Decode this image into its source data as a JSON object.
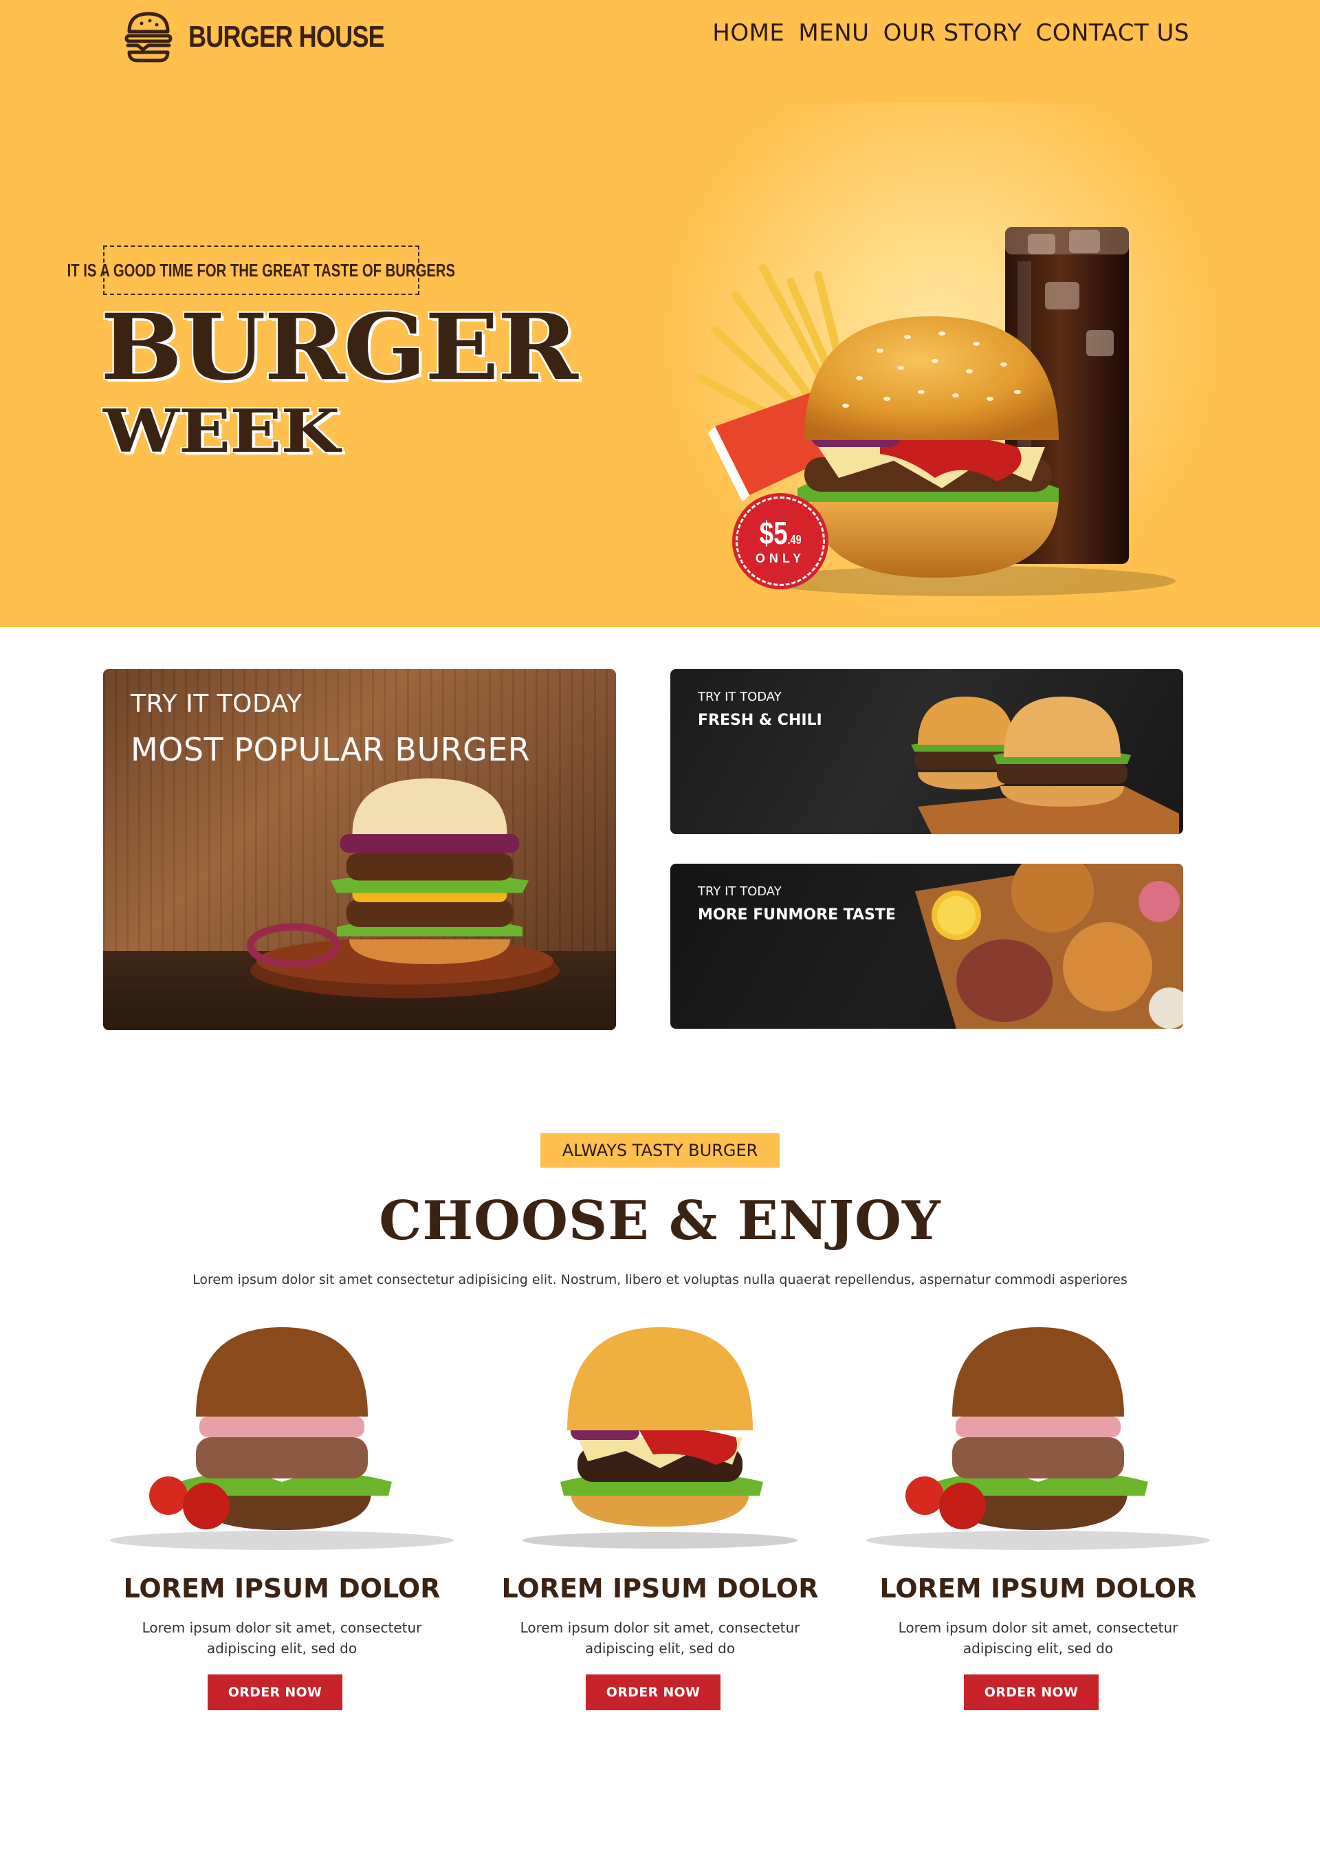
{
  "brand": {
    "name": "BURGER HOUSE",
    "icon": "burger-icon"
  },
  "nav": {
    "items": [
      "HOME",
      "MENU",
      "OUR STORY",
      "CONTACT US"
    ]
  },
  "hero": {
    "tagline": "IT IS A GOOD TIME FOR THE GREAT TASTE OF BURGERS",
    "title_line1": "BURGER",
    "title_line2": "WEEK",
    "price": {
      "dollars": "$5",
      "cents": ".49",
      "label": "ONLY"
    }
  },
  "promos": [
    {
      "kicker": "TRY IT TODAY",
      "title": "MOST POPULAR BURGER"
    },
    {
      "kicker": "TRY IT TODAY",
      "title": "FRESH & CHILI"
    },
    {
      "kicker": "TRY IT TODAY",
      "title": "MORE FUNMORE TASTE"
    }
  ],
  "section": {
    "chip": "ALWAYS TASTY BURGER",
    "title": "CHOOSE & ENJOY",
    "description": "Lorem ipsum dolor sit amet consectetur adipisicing elit. Nostrum, libero et voluptas nulla quaerat repellendus, aspernatur commodi asperiores"
  },
  "products": [
    {
      "name": "LOREM IPSUM DOLOR",
      "description": "Lorem ipsum dolor sit amet, consectetur adipiscing elit, sed do",
      "button": "ORDER NOW"
    },
    {
      "name": "LOREM IPSUM DOLOR",
      "description": "Lorem ipsum dolor sit amet, consectetur adipiscing elit, sed do",
      "button": "ORDER NOW"
    },
    {
      "name": "LOREM IPSUM DOLOR",
      "description": "Lorem ipsum dolor sit amet, consectetur adipiscing elit, sed do",
      "button": "ORDER NOW"
    }
  ],
  "colors": {
    "accent": "#ffc04d",
    "brown": "#3b2314",
    "red": "#c8232b"
  }
}
